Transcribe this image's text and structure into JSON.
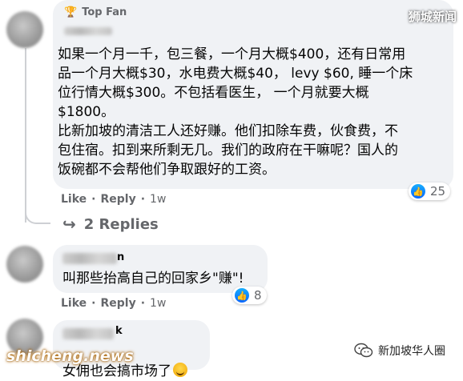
{
  "watermarks": {
    "top_right": "狮城新闻",
    "bottom_left": "shicheng.news",
    "bottom_right": "新加坡华人圈"
  },
  "comment1": {
    "badge": "Top Fan",
    "text": "如果一个月一千，包三餐，一个月大概$400，还有日常用\n品一个月大概$30，水电费大概$40， levy $60, 睡一个床\n位行情大概$300。不包括看医生， 一个月就要大概\n$1800。\n比新加坡的清洁工人还好赚。他们扣除车费，伙食费，不\n包住宿。扣到来所剩无几。我们的政府在干嘛呢？国人的\n饭碗都不会帮他们争取跟好的工资。",
    "like_label": "Like",
    "reply_label": "Reply",
    "time": "1w",
    "reaction_count": "25"
  },
  "replies_toggle": {
    "label": "2 Replies"
  },
  "comment2": {
    "name_fragment": "n",
    "text": "叫那些抬高自己的回家乡\"赚\"!",
    "like_label": "Like",
    "reply_label": "Reply",
    "time": "1w",
    "reaction_count": "8"
  },
  "comment3": {
    "name_fragment": "k",
    "text": "女佣也会搞市场了",
    "emoji": "grinning-squinting-face"
  },
  "separator": "·",
  "colors": {
    "bubble": "#f0f2f5",
    "meta_text": "#65676b",
    "like_blue": "#0966ff"
  }
}
